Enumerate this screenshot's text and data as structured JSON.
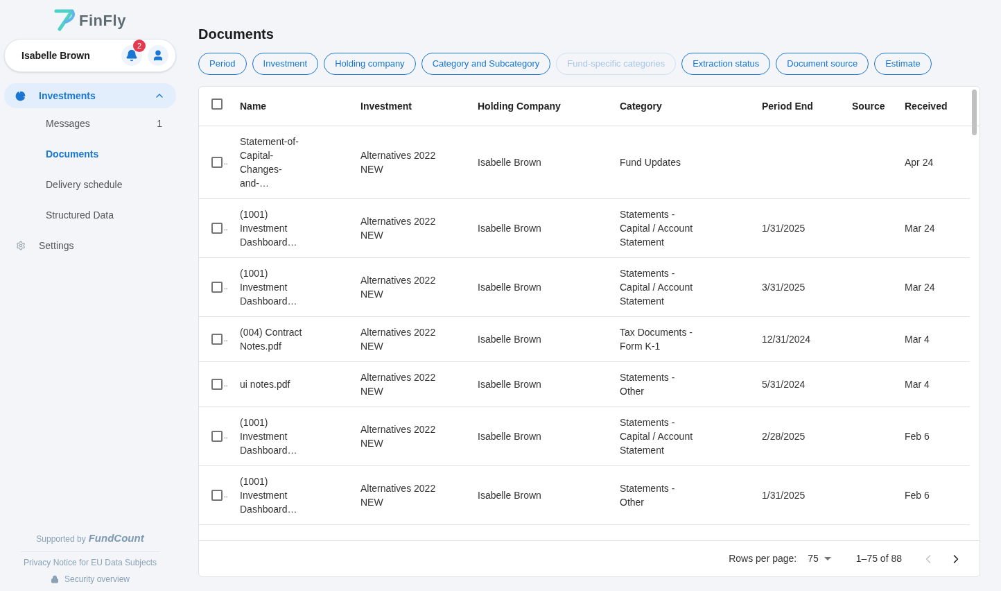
{
  "brand": {
    "name": "FinFly"
  },
  "user": {
    "name": "Isabelle Brown",
    "notifications": "2"
  },
  "nav": [
    {
      "label": "Investments",
      "selected": false,
      "expanded": true,
      "children": [
        {
          "label": "Messages",
          "count": "1",
          "selected": false
        },
        {
          "label": "Documents",
          "selected": true
        },
        {
          "label": "Delivery schedule",
          "selected": false
        },
        {
          "label": "Structured Data",
          "selected": false
        }
      ]
    },
    {
      "label": "Settings",
      "selected": false
    }
  ],
  "footer": {
    "supported_by": "Supported by",
    "partner": "FundCount",
    "privacy": "Privacy Notice for EU Data Subjects",
    "security": "Security overview"
  },
  "page": {
    "title": "Documents"
  },
  "filters": [
    {
      "label": "Period",
      "disabled": false
    },
    {
      "label": "Investment",
      "disabled": false
    },
    {
      "label": "Holding company",
      "disabled": false
    },
    {
      "label": "Category and Subcategory",
      "disabled": false
    },
    {
      "label": "Fund-specific categories",
      "disabled": true
    },
    {
      "label": "Extraction status",
      "disabled": false
    },
    {
      "label": "Document source",
      "disabled": false
    },
    {
      "label": "Estimate",
      "disabled": false
    }
  ],
  "table": {
    "all_checked": false,
    "columns": [
      "Name",
      "Investment",
      "Holding Company",
      "Category",
      "Period End",
      "Source",
      "Received"
    ],
    "rows": [
      {
        "checked": false,
        "select_text": "..",
        "name": "Statement-of-Capital-Changes-and-…",
        "investment": "Alternatives 2022 NEW",
        "holding_company": "Isabelle Brown",
        "category": "Fund Updates",
        "received": "Apr 24"
      },
      {
        "checked": false,
        "select_text": "..",
        "name": "(1001) Investment Dashboard…",
        "investment": "Alternatives 2022 NEW",
        "holding_company": "Isabelle Brown",
        "category": "Statements - Capital / Account Statement",
        "period_end": "1/31/2025",
        "received": "Mar 24"
      },
      {
        "checked": false,
        "select_text": "..",
        "name": "(1001) Investment Dashboard…",
        "investment": "Alternatives 2022 NEW",
        "holding_company": "Isabelle Brown",
        "category": "Statements - Capital / Account Statement",
        "period_end": "3/31/2025",
        "received": "Mar 24"
      },
      {
        "checked": false,
        "select_text": "..",
        "name": "(004) Contract Notes.pdf",
        "investment": "Alternatives 2022 NEW",
        "holding_company": "Isabelle Brown",
        "category": "Tax Documents - Form K-1",
        "period_end": "12/31/2024",
        "received": "Mar 4"
      },
      {
        "checked": false,
        "select_text": "..",
        "name": "ui notes.pdf",
        "investment": "Alternatives 2022 NEW",
        "holding_company": "Isabelle Brown",
        "category": "Statements - Other",
        "period_end": "5/31/2024",
        "received": "Mar 4"
      },
      {
        "checked": false,
        "select_text": "..",
        "name": "(1001) Investment Dashboard…",
        "investment": "Alternatives 2022 NEW",
        "holding_company": "Isabelle Brown",
        "category": "Statements - Capital / Account Statement",
        "period_end": "2/28/2025",
        "received": "Feb 6"
      },
      {
        "checked": false,
        "select_text": "..",
        "name": "(1001) Investment Dashboard…",
        "investment": "Alternatives 2022 NEW",
        "holding_company": "Isabelle Brown",
        "category": "Statements - Other",
        "period_end": "1/31/2025",
        "received": "Feb 6"
      }
    ]
  },
  "pagination": {
    "rows_label": "Rows per page:",
    "rows_value": "75",
    "range": "1–75 of 88",
    "prev_disabled": true,
    "next_disabled": false
  }
}
